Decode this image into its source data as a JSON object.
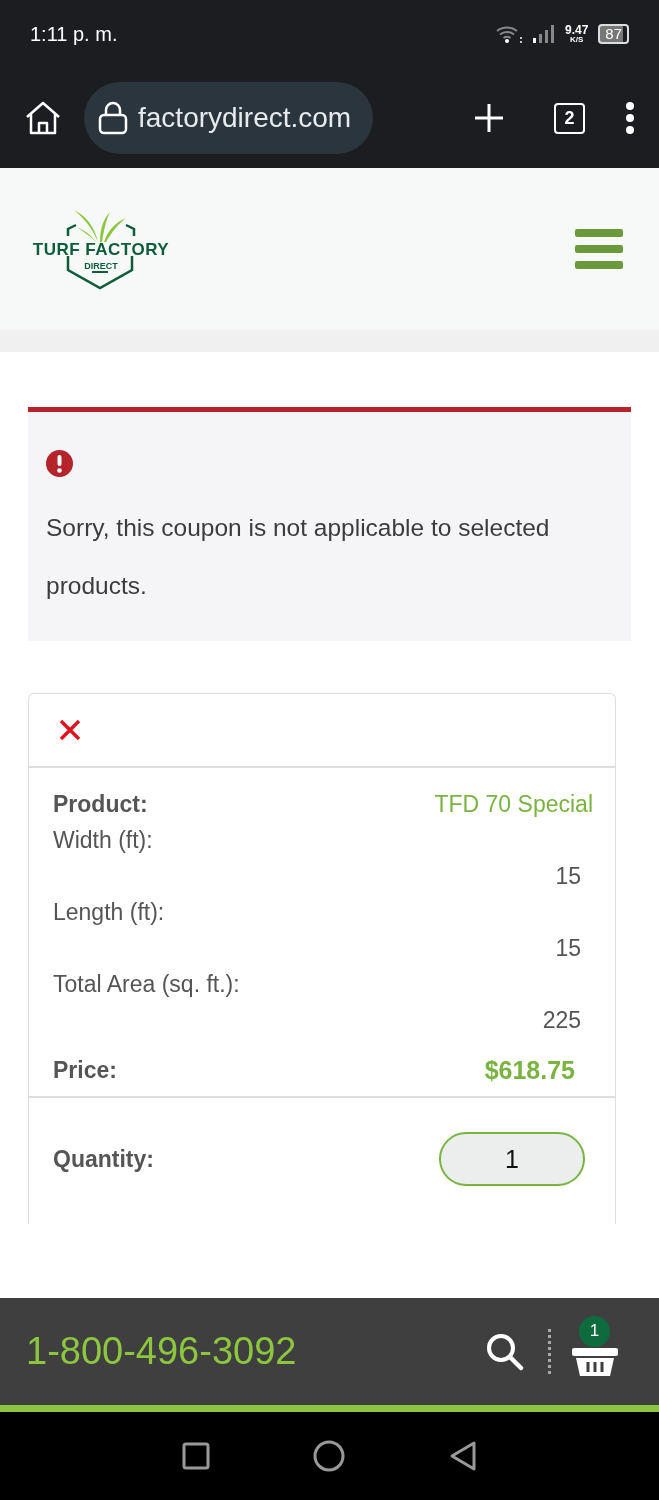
{
  "status_bar": {
    "time": "1:11 p. m.",
    "speed": "9.47",
    "speed_unit": "K/S",
    "battery": "87"
  },
  "browser": {
    "url": "factorydirect.com",
    "tab_count": "2"
  },
  "header": {
    "logo_text": "TURF FACTORY",
    "logo_sub": "DIRECT"
  },
  "alert": {
    "message": "Sorry, this coupon is not applicable to selected products."
  },
  "cart_item": {
    "rows": [
      {
        "kind": "product",
        "label": "Product:",
        "value": "TFD 70 Special"
      },
      {
        "kind": "dimension",
        "label": "Width (ft):",
        "value": "15"
      },
      {
        "kind": "dimension",
        "label": "Length (ft):",
        "value": "15"
      },
      {
        "kind": "dimension",
        "label": "Total Area (sq. ft.):",
        "value": "225"
      },
      {
        "kind": "price",
        "label": "Price:",
        "value": "$618.75"
      }
    ],
    "quantity_label": "Quantity:",
    "quantity": "1"
  },
  "footer": {
    "phone": "1-800-496-3092",
    "cart_count": "1"
  }
}
